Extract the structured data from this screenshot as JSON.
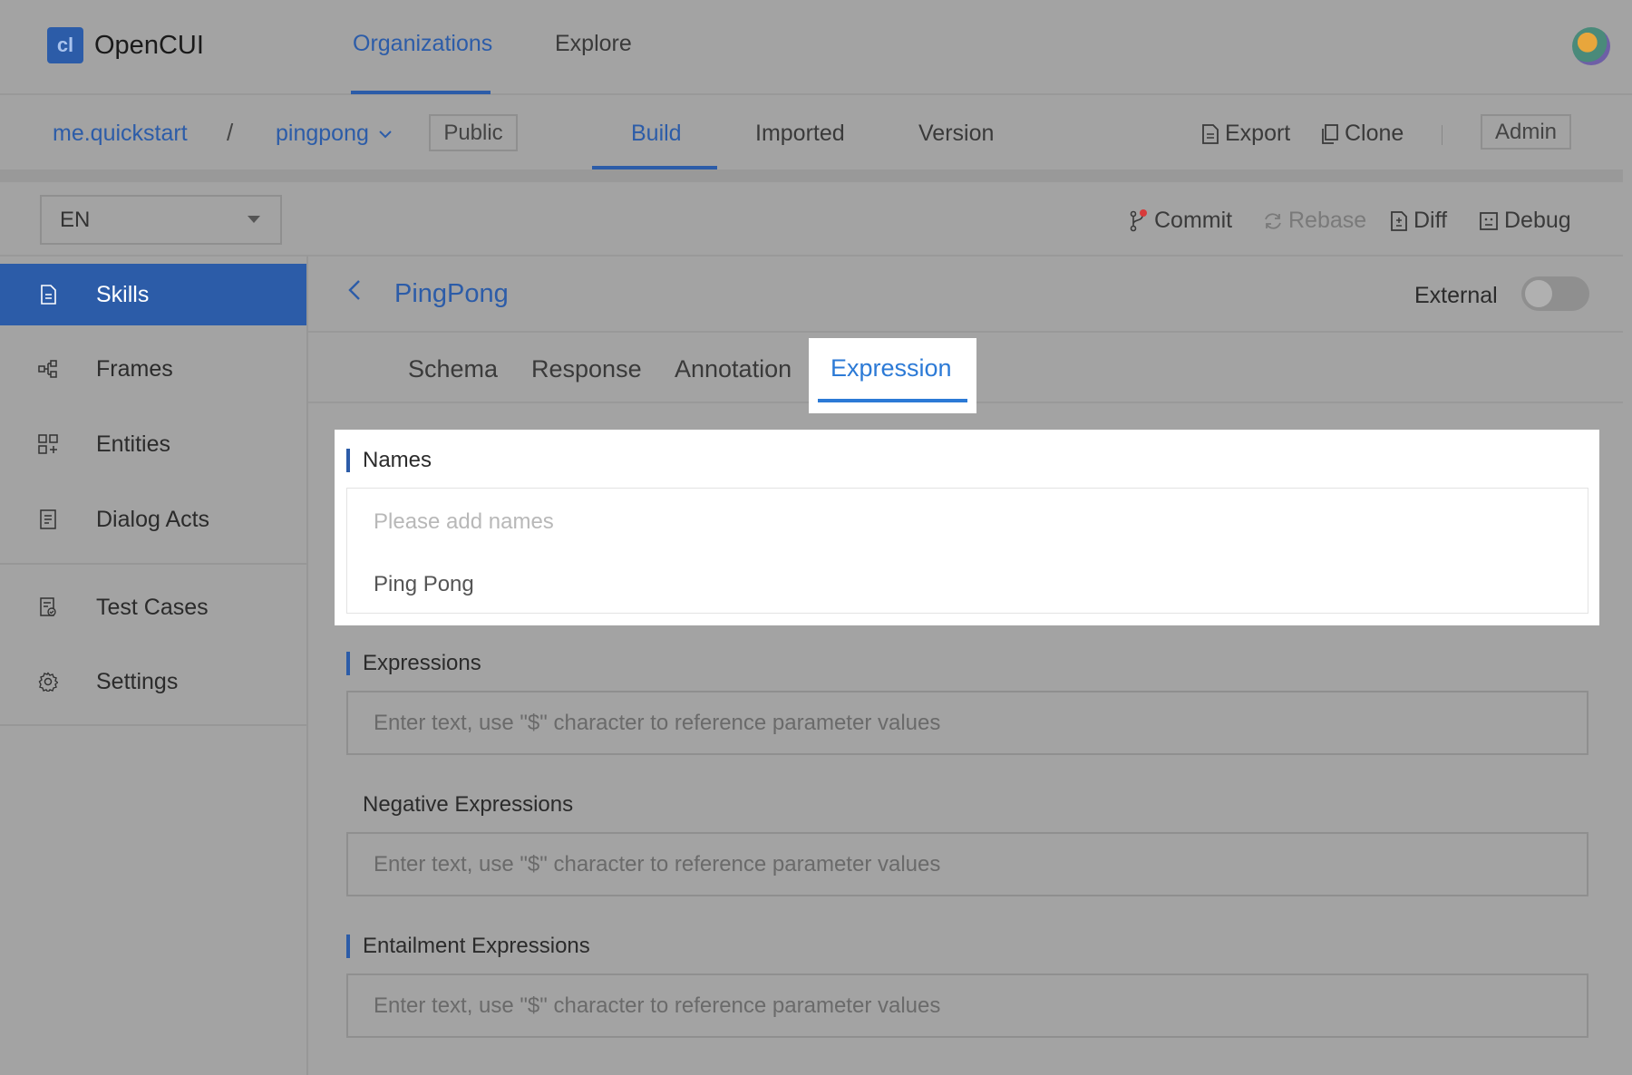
{
  "app": {
    "logo_glyph": "cl",
    "name": "OpenCUI"
  },
  "topnav": {
    "organizations": "Organizations",
    "explore": "Explore"
  },
  "breadcrumb": {
    "org": "me.quickstart",
    "separator": "/",
    "project": "pingpong",
    "visibility": "Public"
  },
  "project_tabs": {
    "build": "Build",
    "imported": "Imported",
    "version": "Version",
    "active": "Build"
  },
  "project_actions": {
    "export": "Export",
    "clone": "Clone",
    "admin": "Admin"
  },
  "toolbar": {
    "language": "EN",
    "commit": "Commit",
    "rebase": "Rebase",
    "diff": "Diff",
    "debug": "Debug"
  },
  "sidebar": {
    "items": [
      {
        "label": "Skills",
        "icon": "document-icon",
        "active": true
      },
      {
        "label": "Frames",
        "icon": "frames-icon"
      },
      {
        "label": "Entities",
        "icon": "entities-icon"
      },
      {
        "label": "Dialog Acts",
        "icon": "dialog-acts-icon"
      },
      {
        "label": "Test Cases",
        "icon": "test-cases-icon"
      },
      {
        "label": "Settings",
        "icon": "gear-icon"
      }
    ]
  },
  "skill": {
    "title": "PingPong",
    "external_label": "External",
    "external_on": false
  },
  "skill_tabs": {
    "schema": "Schema",
    "response": "Response",
    "annotation": "Annotation",
    "expression": "Expression",
    "active": "Expression"
  },
  "names": {
    "title": "Names",
    "placeholder": "Please add names",
    "items": [
      "Ping Pong"
    ]
  },
  "expressions": {
    "title": "Expressions",
    "placeholder": "Enter text, use \"$\" character to reference parameter values"
  },
  "negative_expressions": {
    "title": "Negative Expressions",
    "placeholder": "Enter text, use \"$\" character to reference parameter values"
  },
  "entailment_expressions": {
    "title": "Entailment Expressions",
    "placeholder": "Enter text, use \"$\" character to reference parameter values"
  },
  "colors": {
    "accent": "#2c5ca8",
    "active_tab": "#2c7ad6",
    "overlay": "#a3a3a3",
    "notification_dot": "#d83a3a"
  }
}
